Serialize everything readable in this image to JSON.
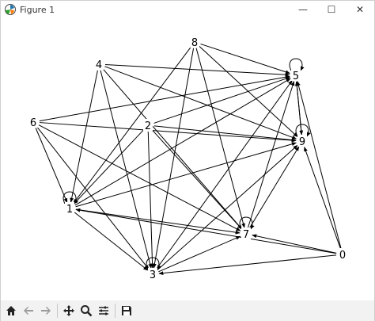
{
  "window": {
    "title": "Figure 1",
    "controls": {
      "minimize": "—",
      "maximize": "☐",
      "close": "✕"
    }
  },
  "graph": {
    "nodes": [
      {
        "id": "0",
        "label": "0"
      },
      {
        "id": "1",
        "label": "1"
      },
      {
        "id": "2",
        "label": "2"
      },
      {
        "id": "3",
        "label": "3"
      },
      {
        "id": "4",
        "label": "4"
      },
      {
        "id": "5",
        "label": "5"
      },
      {
        "id": "6",
        "label": "6"
      },
      {
        "id": "7",
        "label": "7"
      },
      {
        "id": "8",
        "label": "8"
      },
      {
        "id": "9",
        "label": "9"
      }
    ],
    "edges": [
      [
        "4",
        "5"
      ],
      [
        "4",
        "9"
      ],
      [
        "4",
        "1"
      ],
      [
        "4",
        "3"
      ],
      [
        "4",
        "7"
      ],
      [
        "8",
        "5"
      ],
      [
        "8",
        "9"
      ],
      [
        "8",
        "1"
      ],
      [
        "8",
        "3"
      ],
      [
        "8",
        "7"
      ],
      [
        "6",
        "5"
      ],
      [
        "6",
        "9"
      ],
      [
        "6",
        "1"
      ],
      [
        "6",
        "3"
      ],
      [
        "6",
        "7"
      ],
      [
        "2",
        "5"
      ],
      [
        "2",
        "9"
      ],
      [
        "2",
        "1"
      ],
      [
        "2",
        "3"
      ],
      [
        "2",
        "7"
      ],
      [
        "0",
        "5"
      ],
      [
        "0",
        "9"
      ],
      [
        "0",
        "1"
      ],
      [
        "0",
        "3"
      ],
      [
        "0",
        "7"
      ],
      [
        "1",
        "5"
      ],
      [
        "1",
        "9"
      ],
      [
        "1",
        "3"
      ],
      [
        "1",
        "7"
      ],
      [
        "3",
        "5"
      ],
      [
        "3",
        "9"
      ],
      [
        "3",
        "7"
      ],
      [
        "7",
        "5"
      ],
      [
        "7",
        "9"
      ],
      [
        "9",
        "5"
      ],
      [
        "5",
        "9"
      ]
    ],
    "self_loops": [
      "1",
      "3",
      "5",
      "7",
      "9"
    ]
  },
  "toolbar": {
    "items": [
      {
        "name": "home-icon",
        "glyph": "⌂"
      },
      {
        "name": "back-icon",
        "glyph": "←"
      },
      {
        "name": "forward-icon",
        "glyph": "→"
      },
      {
        "name": "pan-icon",
        "glyph": "✥"
      },
      {
        "name": "zoom-icon",
        "glyph": "🔍"
      },
      {
        "name": "configure-icon",
        "glyph": "⚙"
      },
      {
        "name": "save-icon",
        "glyph": "💾"
      }
    ]
  }
}
